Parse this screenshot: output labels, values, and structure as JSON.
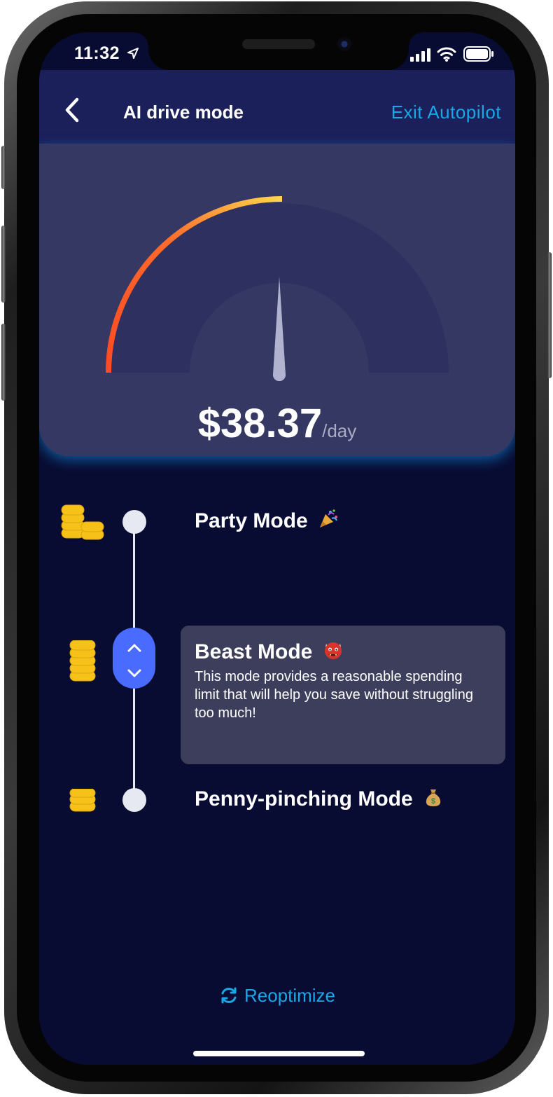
{
  "status_bar": {
    "time": "11:32"
  },
  "header": {
    "title": "AI drive mode",
    "exit_label": "Exit Autopilot"
  },
  "gauge": {
    "amount": "$38.37",
    "unit": "/day"
  },
  "modes": [
    {
      "title": "Party Mode"
    },
    {
      "title": "Beast Mode",
      "description": "This mode provides a reasonable spending limit that will help you save without struggling too much!",
      "selected": true
    },
    {
      "title": "Penny-pinching Mode"
    }
  ],
  "footer": {
    "reoptimize_label": "Reoptimize"
  },
  "colors": {
    "accent": "#1aa7e6",
    "handle": "#4a6bff",
    "gauge_start": "#ff5722",
    "gauge_end": "#ffd54f"
  },
  "icons": [
    "location-arrow-icon",
    "signal-icon",
    "wifi-icon",
    "battery-icon",
    "back-chevron-icon",
    "party-popper-icon",
    "ogre-icon",
    "money-bag-icon",
    "coins-icon",
    "refresh-icon"
  ]
}
